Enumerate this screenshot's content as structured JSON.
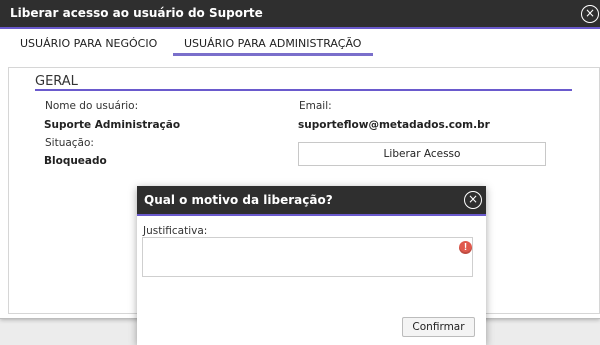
{
  "window": {
    "title": "Liberar acesso ao usuário do Suporte",
    "close_icon": "×"
  },
  "tabs": [
    {
      "label": "USUÁRIO PARA NEGÓCIO",
      "active": false
    },
    {
      "label": "USUÁRIO PARA ADMINISTRAÇÃO",
      "active": true
    }
  ],
  "section": {
    "title": "GERAL"
  },
  "fields": {
    "user_name_label": "Nome do usuário:",
    "user_name_value": "Suporte Administração",
    "email_label": "Email:",
    "email_value": "suporteflow@metadados.com.br",
    "status_label": "Situação:",
    "status_value": "Bloqueado"
  },
  "release_button": "Liberar Acesso",
  "modal": {
    "title": "Qual o motivo da liberação?",
    "close_icon": "×",
    "justification_label": "Justificativa:",
    "justification_value": "",
    "warning_icon": "!",
    "confirm_button": "Confirmar"
  },
  "colors": {
    "titlebar": "#2f2f2f",
    "accent": "#6a5acd",
    "warning": "#e05a4e"
  }
}
